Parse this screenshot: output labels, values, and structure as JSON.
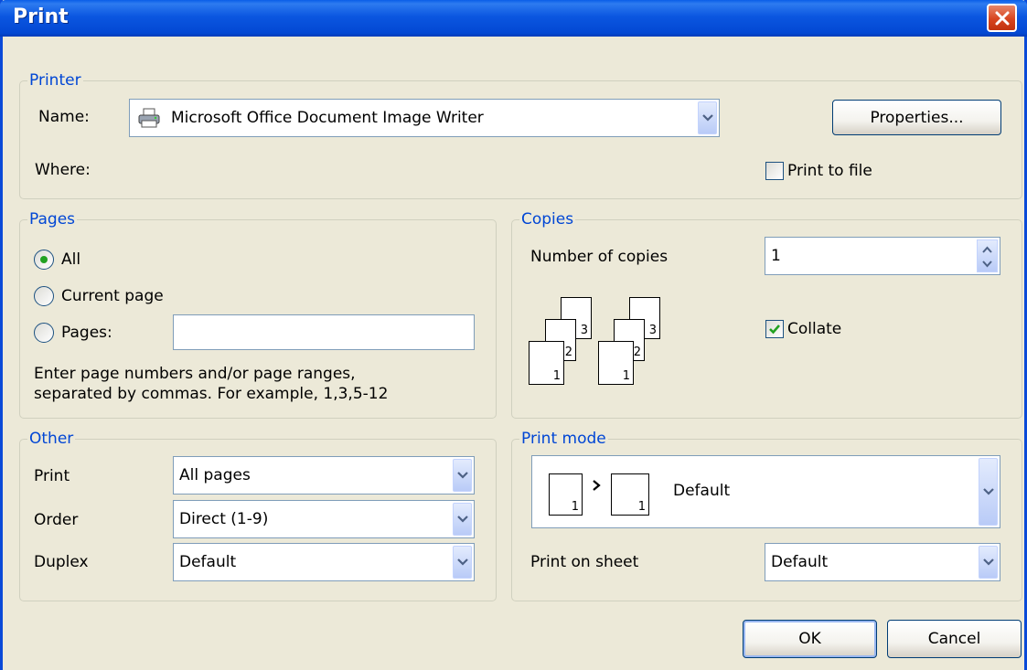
{
  "window": {
    "title": "Print"
  },
  "printer": {
    "group_label": "Printer",
    "name_label": "Name:",
    "name_value": "Microsoft Office Document Image Writer",
    "where_label": "Where:",
    "properties_button": "Properties...",
    "print_to_file_label": "Print to file",
    "print_to_file_checked": false
  },
  "pages": {
    "group_label": "Pages",
    "all_label": "All",
    "current_label": "Current page",
    "pages_label": "Pages:",
    "pages_value": "",
    "selected": "All",
    "hint_line1": "Enter page numbers and/or page ranges,",
    "hint_line2": "separated by commas. For example, 1,3,5-12"
  },
  "copies": {
    "group_label": "Copies",
    "number_label": "Number of copies",
    "number_value": "1",
    "collate_label": "Collate",
    "collate_checked": true,
    "page_numbers": [
      "1",
      "2",
      "3"
    ]
  },
  "other": {
    "group_label": "Other",
    "print_label": "Print",
    "print_value": "All pages",
    "order_label": "Order",
    "order_value": "Direct (1-9)",
    "duplex_label": "Duplex",
    "duplex_value": "Default"
  },
  "print_mode": {
    "group_label": "Print mode",
    "mode_value": "Default",
    "mode_page_number": "1",
    "sheet_label": "Print on sheet",
    "sheet_value": "Default"
  },
  "buttons": {
    "ok": "OK",
    "cancel": "Cancel"
  },
  "colors": {
    "titlebar": "#0a5ee8",
    "group_label": "#0046d5",
    "check": "#21a121",
    "close": "#d8451f"
  }
}
